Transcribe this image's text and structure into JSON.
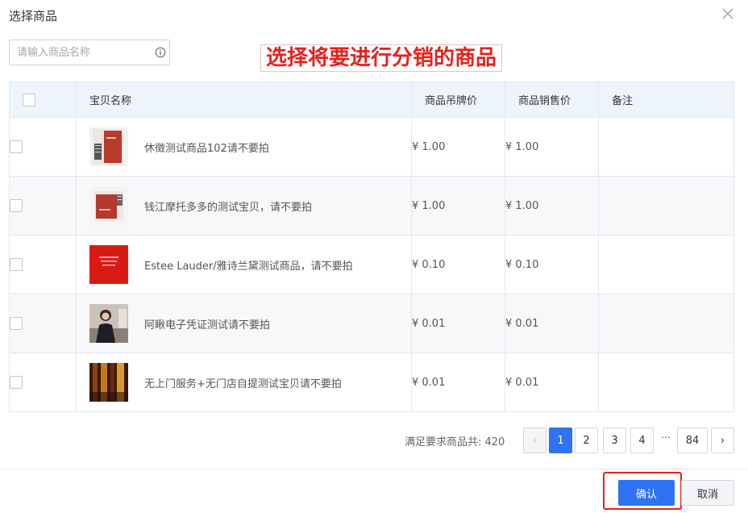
{
  "dialog": {
    "title": "选择商品",
    "annotation": "选择将要进行分销的商品"
  },
  "search": {
    "placeholder": "请输入商品名称",
    "value": ""
  },
  "table": {
    "columns": [
      "宝贝名称",
      "商品吊牌价",
      "商品销售价",
      "备注"
    ],
    "rows": [
      {
        "name": "休徵测试商品102请不要拍",
        "tag_price": "¥ 1.00",
        "sale_price": "¥ 1.00",
        "note": ""
      },
      {
        "name": "钱江摩托多多的测试宝贝，请不要拍",
        "tag_price": "¥ 1.00",
        "sale_price": "¥ 1.00",
        "note": ""
      },
      {
        "name": "Estee Lauder/雅诗兰黛测试商品，请不要拍",
        "tag_price": "¥ 0.10",
        "sale_price": "¥ 0.10",
        "note": ""
      },
      {
        "name": "阿瞅电子凭证测试请不要拍",
        "tag_price": "¥ 0.01",
        "sale_price": "¥ 0.01",
        "note": ""
      },
      {
        "name": "无上门服务+无门店自提测试宝贝请不要拍",
        "tag_price": "¥ 0.01",
        "sale_price": "¥ 0.01",
        "note": ""
      }
    ]
  },
  "pagination": {
    "total_label": "满足要求商品共: 420",
    "prev": "‹",
    "pages": [
      "1",
      "2",
      "3",
      "4"
    ],
    "ellipsis": "···",
    "last": "84",
    "next": "›",
    "current": "1"
  },
  "footer": {
    "confirm_label": "确认",
    "cancel_label": "取消"
  },
  "colors": {
    "primary": "#2f73f5",
    "annotation_red": "#e8221c",
    "header_bg": "#eef4fc"
  }
}
